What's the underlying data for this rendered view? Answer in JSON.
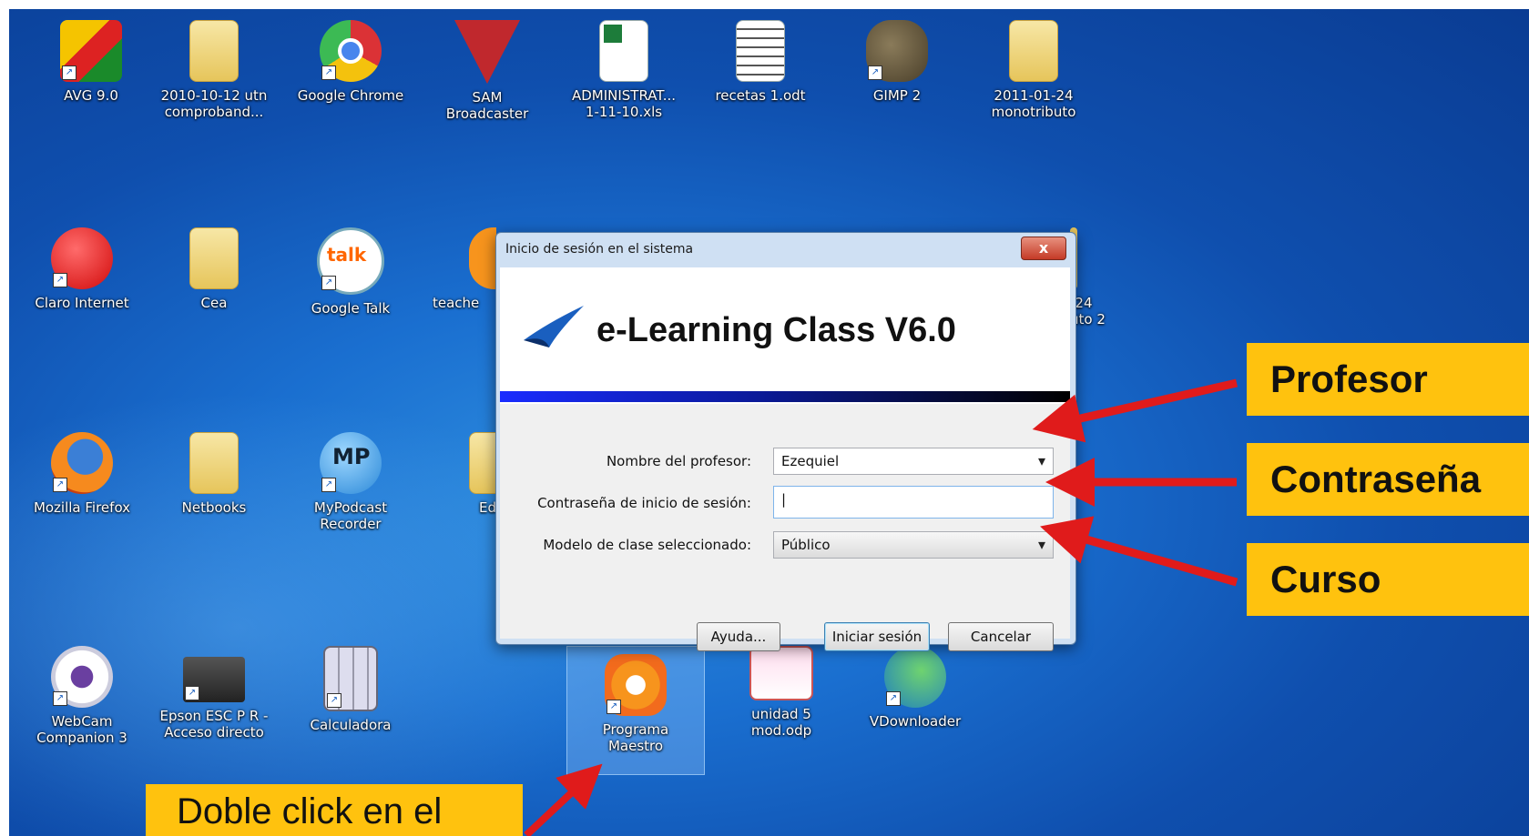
{
  "desktop": {
    "icons": [
      {
        "label": "AVG 9.0",
        "icon": "avg-icon"
      },
      {
        "label": "2010-10-12 utn\ncomproband...",
        "icon": "folder-icon"
      },
      {
        "label": "Google Chrome",
        "icon": "chrome-icon"
      },
      {
        "label": "SAM\nBroadcaster",
        "icon": "sam-broadcaster-icon"
      },
      {
        "label": "ADMINISTRAT...\n1-11-10.xls",
        "icon": "spreadsheet-icon"
      },
      {
        "label": "recetas 1.odt",
        "icon": "document-icon"
      },
      {
        "label": "GIMP 2",
        "icon": "gimp-icon"
      },
      {
        "label": "2011-01-24\nmonotributo",
        "icon": "folder-icon"
      },
      {
        "label": "Claro Internet",
        "icon": "claro-icon"
      },
      {
        "label": "Cea",
        "icon": "folder-icon"
      },
      {
        "label": "Google Talk",
        "icon": "talk-icon"
      },
      {
        "label": "teache",
        "icon": "teacher-icon"
      },
      {
        "label": "-24\nuto 2",
        "icon": "folder-icon"
      },
      {
        "label": "Mozilla Firefox",
        "icon": "firefox-icon"
      },
      {
        "label": "Netbooks",
        "icon": "folder-icon"
      },
      {
        "label": "MyPodcast\nRecorder",
        "icon": "mp-icon"
      },
      {
        "label": "Ed",
        "icon": "folder-icon"
      },
      {
        "label": "WebCam\nCompanion 3",
        "icon": "webcam-icon"
      },
      {
        "label": "Epson ESC P R -\nAcceso directo",
        "icon": "printer-icon"
      },
      {
        "label": "Calculadora",
        "icon": "calculator-icon"
      },
      {
        "label": "Programa\nMaestro",
        "icon": "programa-maestro-icon"
      },
      {
        "label": "unidad 5\nmod.odp",
        "icon": "presentation-icon"
      },
      {
        "label": "VDownloader",
        "icon": "vdownloader-icon"
      }
    ]
  },
  "dialog": {
    "title": "Inicio de sesión en el sistema",
    "close_label": "x",
    "app_title": "e-Learning Class V6.0",
    "fields": {
      "teacher_label": "Nombre del profesor:",
      "teacher_value": "Ezequiel",
      "password_label": "Contraseña de inicio de sesión:",
      "password_value": "|",
      "model_label": "Modelo de clase seleccionado:",
      "model_value": "Público"
    },
    "buttons": {
      "help": "Ayuda...",
      "login": "Iniciar sesión",
      "cancel": "Cancelar"
    }
  },
  "callouts": {
    "profesor": "Profesor",
    "contrasena": "Contraseña",
    "curso": "Curso",
    "doble_click": "Doble click en el"
  },
  "colors": {
    "callout_bg": "#ffc20e",
    "arrow": "#e01b1b",
    "desktop": "#1a6fd0"
  }
}
